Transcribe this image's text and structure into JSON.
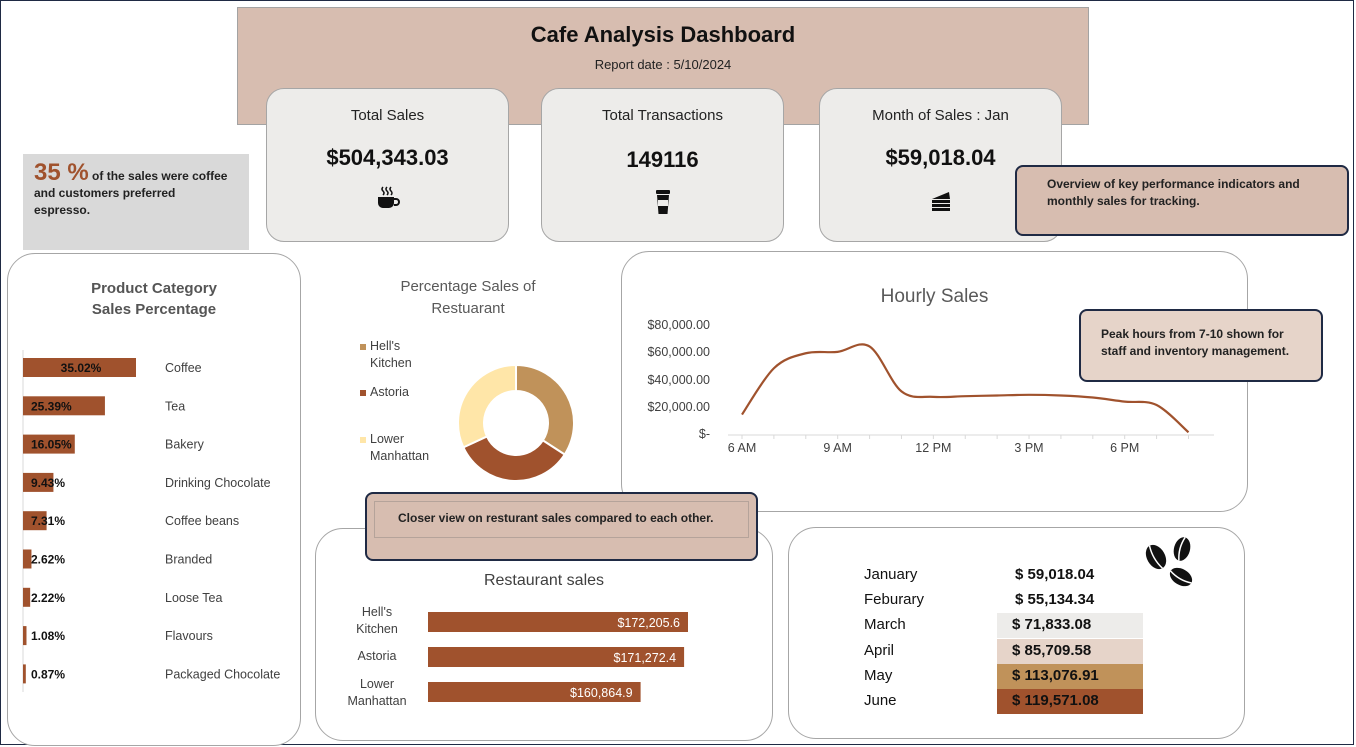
{
  "header": {
    "title": "Cafe Analysis Dashboard",
    "report_date": "Report date : 5/10/2024"
  },
  "kpis": [
    {
      "label": "Total Sales",
      "value": "$504,343.03",
      "icon": "coffee-cup-icon"
    },
    {
      "label": "Total Transactions",
      "value": "149116",
      "icon": "takeaway-cup-icon"
    },
    {
      "label": "Month of Sales : Jan",
      "value": "$59,018.04",
      "icon": "cake-slice-icon"
    }
  ],
  "coffee_note": {
    "pct": "35 %",
    "text_line1": " of the sales were coffee",
    "text_line2": "and customers preferred",
    "text_line3": "espresso."
  },
  "notes": {
    "kpi": {
      "line1": "Overview of key performance indicators and",
      "line2": "monthly sales for tracking."
    },
    "peak": {
      "line1": "Peak hours from 7-10 shown for",
      "line2": "staff and inventory management."
    },
    "restaurant": "Closer view on resturant sales compared to each other."
  },
  "colors": {
    "brown": "#a0522d",
    "header_bg": "#d7bdb0",
    "tan": "#c0925a",
    "cream": "#ffe6a8",
    "light_grey": "#edecea"
  },
  "chart_data": [
    {
      "type": "bar",
      "title": "Product Category Sales Percentage",
      "title_line1": "Product Category",
      "title_line2": "Sales Percentage",
      "categories": [
        "Coffee",
        "Tea",
        "Bakery",
        "Drinking Chocolate",
        "Coffee beans",
        "Branded",
        "Loose Tea",
        "Flavours",
        "Packaged Chocolate"
      ],
      "values": [
        35.02,
        25.39,
        16.05,
        9.43,
        7.31,
        2.62,
        2.22,
        1.08,
        0.87
      ],
      "data_labels": [
        "35.02%",
        "25.39%",
        "16.05%",
        "9.43%",
        "7.31%",
        "2.62%",
        "2.22%",
        "1.08%",
        "0.87%"
      ],
      "orientation": "horizontal",
      "color": "#a0522d"
    },
    {
      "type": "pie",
      "title_line1": "Percentage Sales of",
      "title_line2": "Restuarant",
      "labels": [
        "Hell's Kitchen",
        "Astoria",
        "Lower Manhattan"
      ],
      "legend_lines": [
        [
          "Hell's",
          "Kitchen"
        ],
        [
          "Astoria"
        ],
        [
          "Lower",
          "Manhattan"
        ]
      ],
      "values": [
        172205.6,
        171272.4,
        160864.9
      ],
      "colors": [
        "#c0925a",
        "#a0522d",
        "#ffe6a8"
      ],
      "donut": true,
      "legend_position": "left"
    },
    {
      "type": "line",
      "title": "Hourly Sales",
      "x": [
        6,
        7,
        8,
        9,
        10,
        11,
        12,
        13,
        14,
        15,
        16,
        17,
        18,
        19,
        20
      ],
      "x_tick_labels": [
        "6 AM",
        "9 AM",
        "12 PM",
        "3 PM",
        "6 PM"
      ],
      "x_tick_values": [
        6,
        9,
        12,
        15,
        18
      ],
      "series": [
        {
          "values": [
            15000,
            49000,
            60000,
            61000,
            65000,
            32000,
            28000,
            28500,
            29000,
            29500,
            29000,
            27500,
            24500,
            22000,
            2000
          ]
        }
      ],
      "y_tick_labels": [
        "$-",
        "$20,000.00",
        "$40,000.00",
        "$60,000.00",
        "$80,000.00"
      ],
      "ylim": [
        0,
        80000
      ],
      "xlim": [
        6,
        20.8
      ],
      "grid": false,
      "color": "#a0522d"
    },
    {
      "type": "bar",
      "title": "Restaurant sales",
      "categories": [
        "Hell's Kitchen",
        "Astoria",
        "Lower Manhattan"
      ],
      "category_lines": [
        [
          "Hell's",
          "Kitchen"
        ],
        [
          "Astoria"
        ],
        [
          "Lower",
          "Manhattan"
        ]
      ],
      "values": [
        172205.6,
        171272.4,
        160864.9
      ],
      "data_labels": [
        "$172,205.6",
        "$171,272.4",
        "$160,864.9"
      ],
      "axis_min": 110000,
      "orientation": "horizontal",
      "color": "#a0522d"
    },
    {
      "type": "table",
      "rows": [
        {
          "month": "January",
          "value": "$ 59,018.04",
          "num": 59018.04,
          "fill": null
        },
        {
          "month": "Feburary",
          "value": "$ 55,134.34",
          "num": 55134.34,
          "fill": null
        },
        {
          "month": "March",
          "value": "$ 71,833.08",
          "num": 71833.08,
          "fill": "#edecea"
        },
        {
          "month": "April",
          "value": "$ 85,709.58",
          "num": 85709.58,
          "fill": "#e6d4c9"
        },
        {
          "month": "May",
          "value": "$ 113,076.91",
          "num": 113076.91,
          "fill": "#c0925a"
        },
        {
          "month": "June",
          "value": "$ 119,571.08",
          "num": 119571.08,
          "fill": "#a0522d"
        }
      ],
      "icon": "coffee-beans-icon"
    }
  ]
}
